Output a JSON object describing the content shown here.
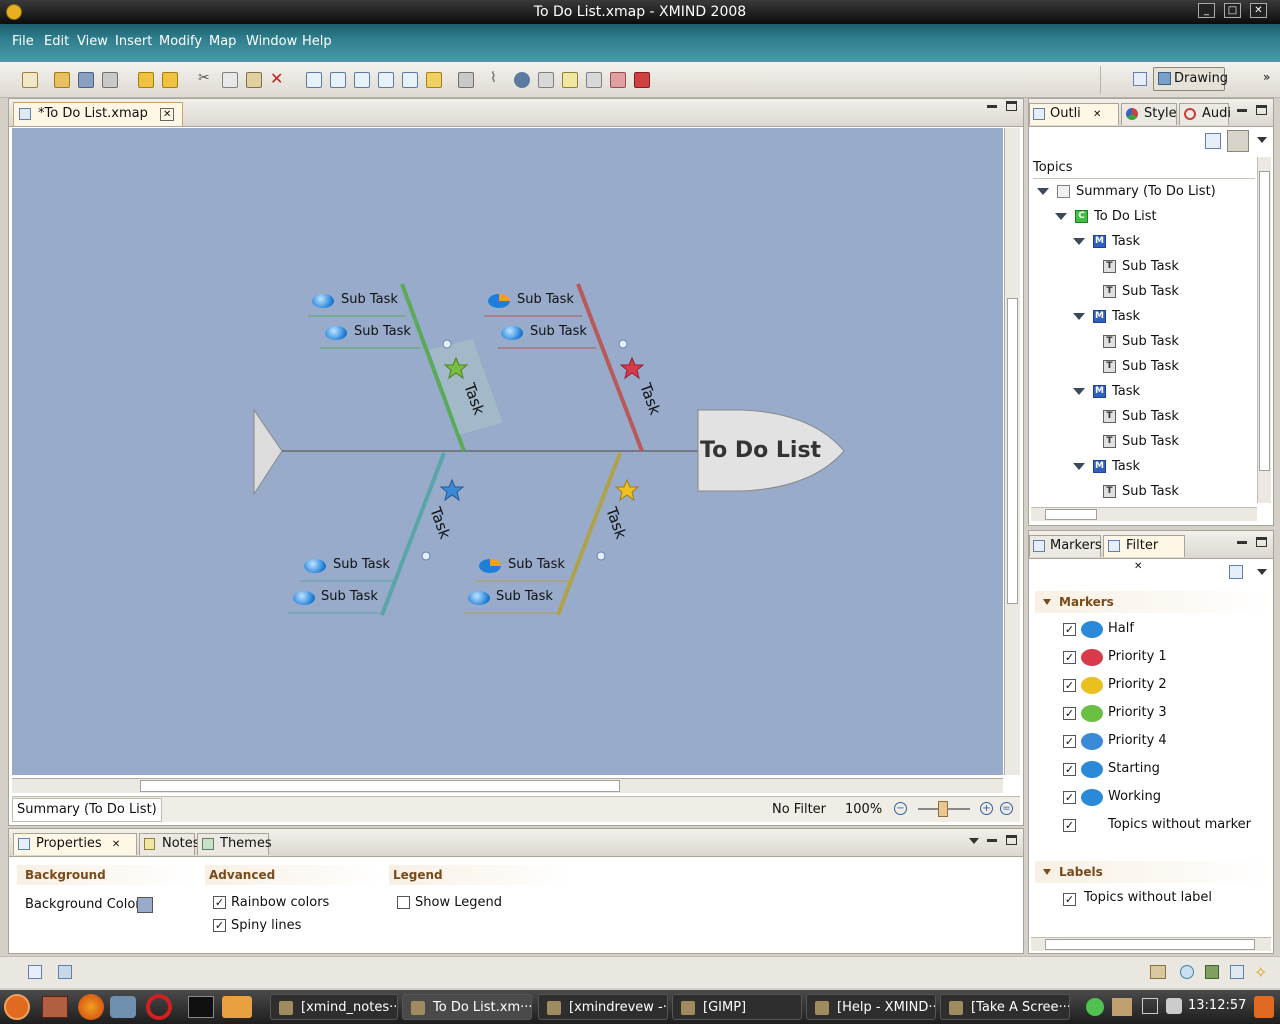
{
  "window": {
    "title": "To Do List.xmap - XMIND 2008"
  },
  "menu": [
    "File",
    "Edit",
    "View",
    "Insert",
    "Modify",
    "Map",
    "Window",
    "Help"
  ],
  "perspective": {
    "label": "Drawing"
  },
  "editor": {
    "tab_label": "*To Do List.xmap",
    "central_topic": "To Do List",
    "branches": [
      {
        "label": "Task",
        "priority": "3",
        "color": "#5aaa5a",
        "subtasks": [
          "Sub Task",
          "Sub Task"
        ]
      },
      {
        "label": "Task",
        "priority": "1",
        "color": "#b85a5a",
        "subtasks": [
          "Sub Task",
          "Sub Task"
        ]
      },
      {
        "label": "Task",
        "priority": "4",
        "color": "#5aa6a6",
        "subtasks": [
          "Sub Task",
          "Sub Task"
        ]
      },
      {
        "label": "Task",
        "priority": "2",
        "color": "#b0a24a",
        "subtasks": [
          "Sub Task",
          "Sub Task"
        ]
      }
    ],
    "status_selection": "Summary (To Do List)",
    "filter_status": "No Filter",
    "zoom": "100%"
  },
  "outline": {
    "tabs": [
      "Outli",
      "Style",
      "Audi"
    ],
    "header": "Topics",
    "rows": [
      {
        "label": "Summary (To Do List)",
        "icon": "summary",
        "indent": 0
      },
      {
        "label": "To Do List",
        "icon": "C",
        "indent": 1
      },
      {
        "label": "Task",
        "icon": "M",
        "indent": 2
      },
      {
        "label": "Sub Task",
        "icon": "T",
        "indent": 3
      },
      {
        "label": "Sub Task",
        "icon": "T",
        "indent": 3
      },
      {
        "label": "Task",
        "icon": "M",
        "indent": 2
      },
      {
        "label": "Sub Task",
        "icon": "T",
        "indent": 3
      },
      {
        "label": "Sub Task",
        "icon": "T",
        "indent": 3
      },
      {
        "label": "Task",
        "icon": "M",
        "indent": 2
      },
      {
        "label": "Sub Task",
        "icon": "T",
        "indent": 3
      },
      {
        "label": "Sub Task",
        "icon": "T",
        "indent": 3
      },
      {
        "label": "Task",
        "icon": "M",
        "indent": 2
      },
      {
        "label": "Sub Task",
        "icon": "T",
        "indent": 3
      }
    ]
  },
  "filter_view": {
    "tabs": [
      "Markers",
      "Filter"
    ],
    "markers_section": "Markers",
    "markers": [
      {
        "label": "Half",
        "color": "#2a8ad8",
        "checked": true
      },
      {
        "label": "Priority 1",
        "color": "#d83a4a",
        "checked": true
      },
      {
        "label": "Priority 2",
        "color": "#e8c020",
        "checked": true
      },
      {
        "label": "Priority 3",
        "color": "#6ac040",
        "checked": true
      },
      {
        "label": "Priority 4",
        "color": "#3a8ad8",
        "checked": true
      },
      {
        "label": "Starting",
        "color": "#2a8ad8",
        "checked": true
      },
      {
        "label": "Working",
        "color": "#2a8ad8",
        "checked": true
      },
      {
        "label": "Topics without marker",
        "color": "",
        "checked": true
      }
    ],
    "labels_section": "Labels",
    "labels": [
      {
        "label": "Topics without label",
        "checked": true
      }
    ]
  },
  "properties": {
    "tabs": [
      "Properties",
      "Notes",
      "Themes"
    ],
    "background": {
      "header": "Background",
      "color_label": "Background Color:",
      "color": "#99abcb"
    },
    "advanced": {
      "header": "Advanced",
      "options": [
        {
          "label": "Rainbow colors",
          "checked": true
        },
        {
          "label": "Spiny lines",
          "checked": true
        }
      ]
    },
    "legend": {
      "header": "Legend",
      "options": [
        {
          "label": "Show Legend",
          "checked": false
        }
      ]
    }
  },
  "taskbar": {
    "items": [
      "[xmind_notes···",
      "To Do List.xm···",
      "[xmindrevew -···",
      "[GIMP]",
      "[Help - XMIND···",
      "[Take A Scree···"
    ],
    "clock": "13:12:57"
  }
}
